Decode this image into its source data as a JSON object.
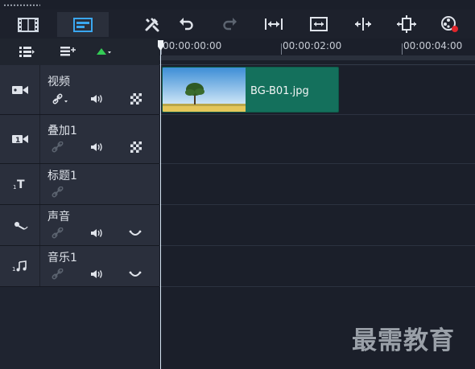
{
  "toolbar": {
    "view_buttons": [
      {
        "name": "storyboard-view",
        "icon": "film-icon",
        "active": false
      },
      {
        "name": "timeline-view",
        "icon": "timeline-icon",
        "active": true
      }
    ],
    "tools": [
      {
        "name": "tools-button",
        "icon": "tools-icon"
      },
      {
        "name": "undo-button",
        "icon": "undo-icon"
      },
      {
        "name": "redo-button",
        "icon": "redo-icon"
      },
      {
        "name": "fit-project-button",
        "icon": "fit-width-icon"
      },
      {
        "name": "fit-window-button",
        "icon": "fit-window-icon"
      },
      {
        "name": "split-button",
        "icon": "split-icon"
      },
      {
        "name": "ripple-button",
        "icon": "ripple-icon"
      },
      {
        "name": "mix-button",
        "icon": "mix-icon"
      }
    ]
  },
  "ruler": {
    "labels": [
      "00:00:00:00",
      "00:00:02:00",
      "00:00:04:00"
    ]
  },
  "tracks": [
    {
      "id": "video",
      "label": "视频",
      "icon": "video-track-icon",
      "controls": [
        "link-dropdown",
        "audio",
        "checker"
      ]
    },
    {
      "id": "overlay",
      "label": "叠加1",
      "icon": "overlay-track-icon",
      "controls": [
        "link",
        "audio",
        "checker"
      ]
    },
    {
      "id": "title",
      "label": "标题1",
      "icon": "title-track-icon",
      "controls": [
        "link"
      ]
    },
    {
      "id": "voice",
      "label": "声音",
      "icon": "voice-track-icon",
      "controls": [
        "link",
        "audio",
        "wave"
      ]
    },
    {
      "id": "music",
      "label": "音乐1",
      "icon": "music-track-icon",
      "controls": [
        "link",
        "audio",
        "wave"
      ]
    }
  ],
  "clip": {
    "label": "BG-B01.jpg",
    "color": "#14705c"
  },
  "watermark": "最需教育",
  "colors": {
    "accent": "#3aa7f0",
    "record": "#e0262b",
    "play": "#33cc55"
  }
}
